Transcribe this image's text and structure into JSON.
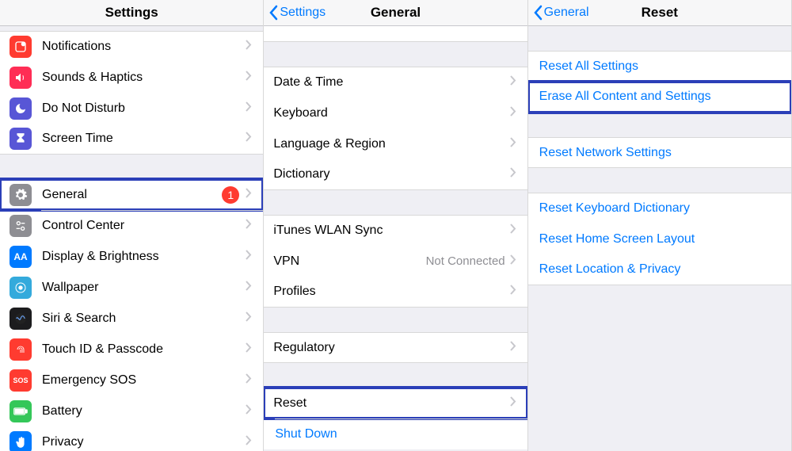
{
  "pane1": {
    "title": "Settings",
    "rows": [
      {
        "label": "Notifications"
      },
      {
        "label": "Sounds & Haptics"
      },
      {
        "label": "Do Not Disturb"
      },
      {
        "label": "Screen Time"
      },
      {
        "label": "General",
        "badge": "1"
      },
      {
        "label": "Control Center"
      },
      {
        "label": "Display & Brightness"
      },
      {
        "label": "Wallpaper"
      },
      {
        "label": "Siri & Search"
      },
      {
        "label": "Touch ID & Passcode"
      },
      {
        "label": "Emergency SOS"
      },
      {
        "label": "Battery"
      },
      {
        "label": "Privacy"
      }
    ]
  },
  "pane2": {
    "back": "Settings",
    "title": "General",
    "rows": {
      "datetime": "Date & Time",
      "keyboard": "Keyboard",
      "language": "Language & Region",
      "dictionary": "Dictionary",
      "itunes": "iTunes WLAN Sync",
      "vpn": "VPN",
      "vpn_value": "Not Connected",
      "profiles": "Profiles",
      "regulatory": "Regulatory",
      "reset": "Reset",
      "shutdown": "Shut Down"
    }
  },
  "pane3": {
    "back": "General",
    "title": "Reset",
    "rows": {
      "reset_all": "Reset All Settings",
      "erase_all": "Erase All Content and Settings",
      "reset_network": "Reset Network Settings",
      "reset_keyboard": "Reset Keyboard Dictionary",
      "reset_home": "Reset Home Screen Layout",
      "reset_location": "Reset Location & Privacy"
    }
  }
}
